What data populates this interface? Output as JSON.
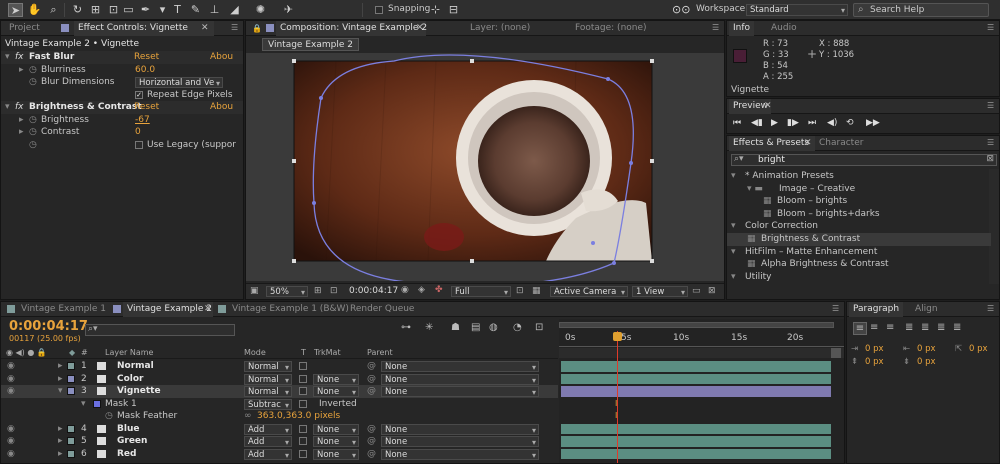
{
  "toolbar": {
    "snapping_label": "Snapping",
    "workspace_label": "Workspace:",
    "workspace_value": "Standard",
    "search_placeholder": "Search Help"
  },
  "effect_panel": {
    "tab_project": "Project",
    "tab_effect_controls": "Effect Controls: Vignette",
    "header": "Vintage Example 2 • Vignette",
    "effects": [
      {
        "name": "Fast Blur",
        "reset": "Reset",
        "about": "Abou"
      },
      {
        "name": "Brightness & Contrast",
        "reset": "Reset",
        "about": "Abou"
      }
    ],
    "blurriness_label": "Blurriness",
    "blurriness_value": "60.0",
    "blur_dimensions_label": "Blur Dimensions",
    "blur_dimensions_value": "Horizontal and Ve",
    "repeat_edge_label": "Repeat Edge Pixels",
    "brightness_label": "Brightness",
    "brightness_value": "-67",
    "contrast_label": "Contrast",
    "contrast_value": "0",
    "legacy_label": "Use Legacy (suppor"
  },
  "composition": {
    "tab_comp": "Composition: Vintage Example 2",
    "tab_layer": "Layer: (none)",
    "tab_footage": "Footage: (none)",
    "breadcrumb": "Vintage Example 2",
    "zoom": "50%",
    "timecode": "0:00:04:17",
    "resolution": "Full",
    "camera": "Active Camera",
    "view": "1 View"
  },
  "info": {
    "tab_info": "Info",
    "tab_audio": "Audio",
    "r": "R : 73",
    "g": "G : 33",
    "b": "B : 54",
    "a": "A : 255",
    "x": "X : 888",
    "y": "Y : 1036",
    "layer_name": "Vignette",
    "swatch_color": "#491e36"
  },
  "preview": {
    "tab": "Preview"
  },
  "effects_presets": {
    "tab": "Effects & Presets",
    "tab_character": "Character",
    "search_value": "bright",
    "items": [
      {
        "label": "* Animation Presets",
        "indent": 0
      },
      {
        "label": "Image – Creative",
        "indent": 1
      },
      {
        "label": "Bloom – brights",
        "indent": 2
      },
      {
        "label": "Bloom – brights+darks",
        "indent": 2
      },
      {
        "label": "Color Correction",
        "indent": 0
      },
      {
        "label": "Brightness & Contrast",
        "indent": 1
      },
      {
        "label": "HitFilm – Matte Enhancement",
        "indent": 0
      },
      {
        "label": "Alpha Brightness & Contrast",
        "indent": 1
      },
      {
        "label": "Utility",
        "indent": 0
      }
    ]
  },
  "timeline": {
    "tabs": [
      "Vintage Example 1",
      "Vintage Example 2",
      "Vintage Example 1 (B&W)",
      "Render Queue"
    ],
    "timecode": "0:00:04:17",
    "frame_info": "00117 (25.00 fps)",
    "search_placeholder": "",
    "col_layer_name": "Layer Name",
    "col_mode": "Mode",
    "col_t": "T",
    "col_trkmat": "TrkMat",
    "col_parent": "Parent",
    "col_hash": "#",
    "ruler": [
      "0s",
      "5s",
      "10s",
      "15s",
      "20s"
    ],
    "layers": [
      {
        "num": "1",
        "name": "Normal",
        "mode": "Normal",
        "trkmat": "",
        "parent": "None",
        "color": "#7f9c9a",
        "bar": "teal"
      },
      {
        "num": "2",
        "name": "Color",
        "mode": "Normal",
        "trkmat": "None",
        "parent": "None",
        "color": "#8a8fbf",
        "bar": "teal"
      },
      {
        "num": "3",
        "name": "Vignette",
        "mode": "Normal",
        "trkmat": "None",
        "parent": "None",
        "color": "#8a8fbf",
        "bar": "purple"
      },
      {
        "num": "4",
        "name": "Blue",
        "mode": "Add",
        "trkmat": "None",
        "parent": "None",
        "color": "#7f9c9a",
        "bar": "teal"
      },
      {
        "num": "5",
        "name": "Green",
        "mode": "Add",
        "trkmat": "None",
        "parent": "None",
        "color": "#7f9c9a",
        "bar": "teal"
      },
      {
        "num": "6",
        "name": "Red",
        "mode": "Add",
        "trkmat": "None",
        "parent": "None",
        "color": "#7f9c9a",
        "bar": "teal"
      }
    ],
    "mask_name": "Mask 1",
    "mask_mode": "Subtrac",
    "mask_inverted": "Inverted",
    "mask_feather_label": "Mask Feather",
    "mask_feather_value": "363.0,363.0 pixels"
  },
  "paragraph": {
    "tab": "Paragraph",
    "tab_align": "Align",
    "val1": "0 px",
    "val2": "0 px",
    "val3": "0 px",
    "val4": "0 px",
    "val5": "0 px"
  }
}
